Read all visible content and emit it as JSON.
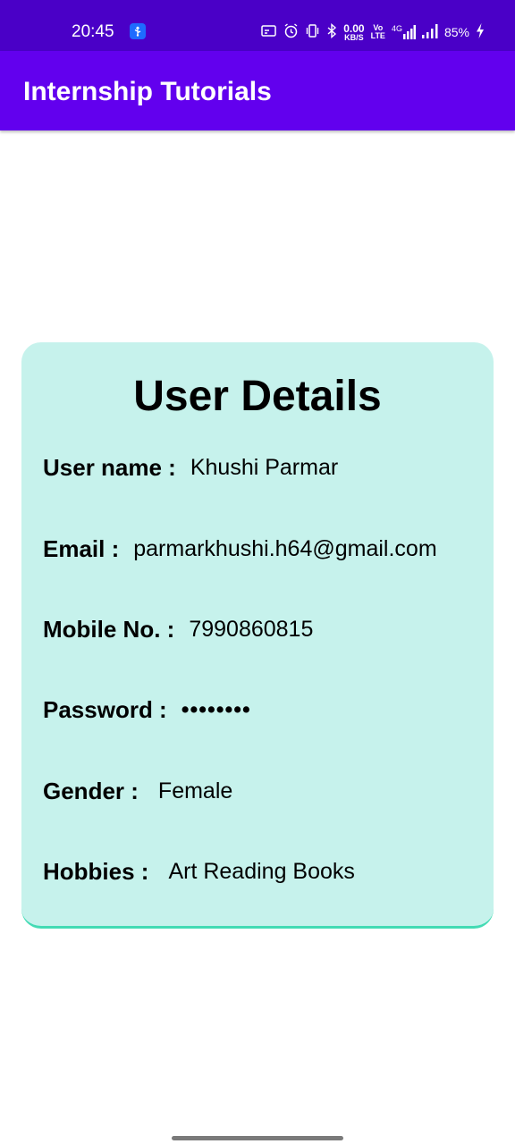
{
  "status_bar": {
    "time": "20:45",
    "data_speed": "0.00",
    "data_speed_unit": "KB/S",
    "volte_top": "Vo",
    "volte_bottom": "LTE",
    "network": "4G",
    "battery": "85%"
  },
  "app_bar": {
    "title": "Internship Tutorials"
  },
  "card": {
    "title": "User Details",
    "fields": [
      {
        "label": "User name :",
        "value": "Khushi Parmar"
      },
      {
        "label": "Email :",
        "value": "parmarkhushi.h64@gmail.com"
      },
      {
        "label": "Mobile No. :",
        "value": "7990860815"
      },
      {
        "label": "Password :",
        "value": "••••••••"
      },
      {
        "label": "Gender :",
        "value": "Female"
      },
      {
        "label": "Hobbies :",
        "value": "Art Reading Books"
      }
    ]
  },
  "colors": {
    "status_bar": "#4a00c7",
    "app_bar": "#6200ee",
    "card_bg": "#c6f2ec",
    "card_border": "#43dbb4"
  }
}
